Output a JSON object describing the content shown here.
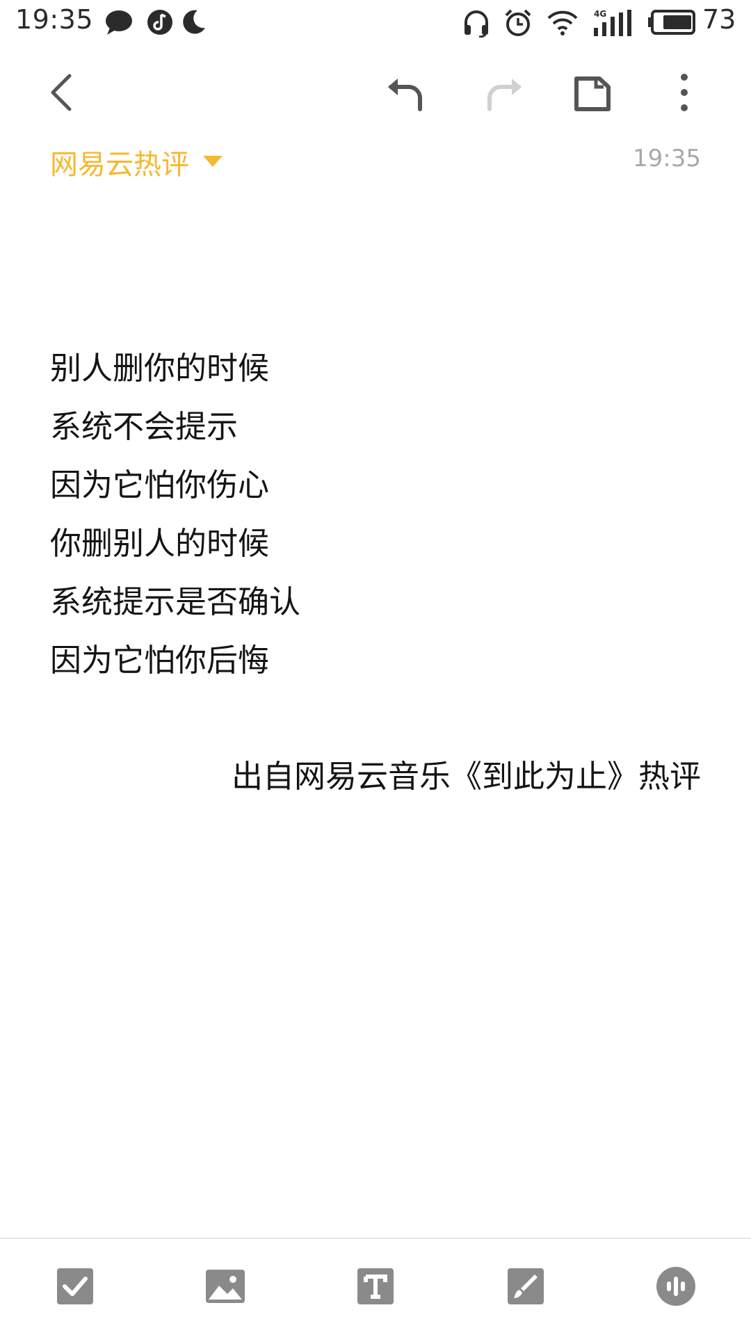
{
  "status_bar": {
    "time": "19:35",
    "battery_level": "73",
    "icons": [
      "chat-bubble-icon",
      "music-app-icon",
      "moon-icon",
      "headphones-icon",
      "alarm-icon",
      "wifi-icon",
      "signal-4g-icon",
      "battery-icon"
    ]
  },
  "toolbar": {
    "icons": [
      "back-icon",
      "undo-icon",
      "redo-icon",
      "tag-icon",
      "more-icon"
    ]
  },
  "note": {
    "folder": "网易云热评",
    "time": "19:35",
    "lines": [
      "别人删你的时候",
      "系统不会提示",
      "因为它怕你伤心",
      "你删别人的时候",
      "系统提示是否确认",
      "因为它怕你后悔"
    ],
    "source": "出自网易云音乐《到此为止》热评"
  },
  "bottom_bar": {
    "icons": [
      "checkbox-icon",
      "image-icon",
      "text-format-icon",
      "brush-icon",
      "voice-icon"
    ]
  },
  "colors": {
    "accent": "#f5b82e",
    "icon_gray": "#8a8a8a",
    "icon_disabled": "#d0d0d0",
    "text": "#141414"
  }
}
